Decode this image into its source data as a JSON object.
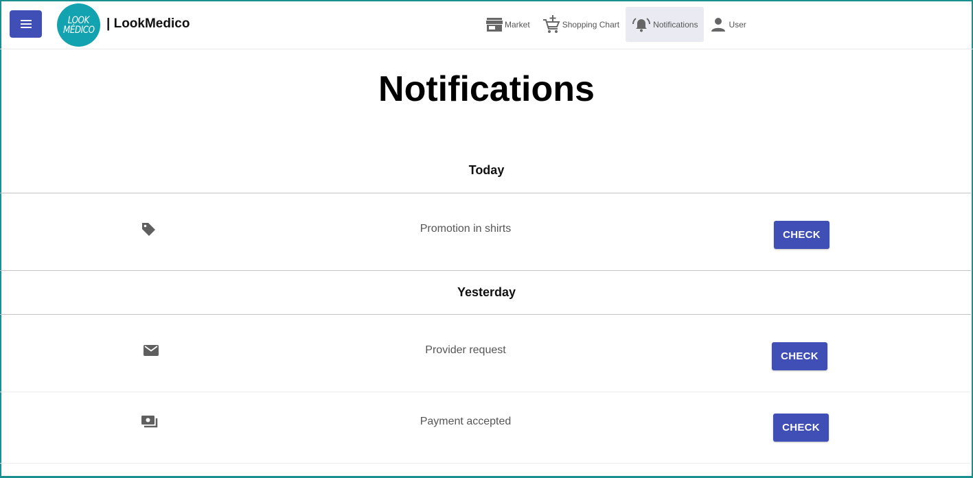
{
  "header": {
    "logo_line1": "LOOK",
    "logo_line2": "MÉDICO",
    "brand": "| LookMedico",
    "nav": [
      {
        "label": "Market",
        "icon": "store-icon"
      },
      {
        "label": "Shopping Chart",
        "icon": "add-shopping-cart-icon"
      },
      {
        "label": "Notifications",
        "icon": "notifications-active-icon",
        "active": true
      },
      {
        "label": "User",
        "icon": "person-icon"
      }
    ]
  },
  "main": {
    "title": "Notifications",
    "sections": [
      {
        "title": "Today",
        "items": [
          {
            "icon": "tag-icon",
            "text": "Promotion in shirts",
            "button": "CHECK"
          }
        ]
      },
      {
        "title": "Yesterday",
        "items": [
          {
            "icon": "mail-icon",
            "text": "Provider request",
            "button": "CHECK"
          },
          {
            "icon": "payments-icon",
            "text": "Payment accepted",
            "button": "CHECK"
          }
        ]
      }
    ]
  },
  "colors": {
    "primary": "#3f4fb5",
    "logo": "#12a2b0",
    "frame": "#1a8f8f",
    "active_nav_bg": "#e9eaf2"
  }
}
